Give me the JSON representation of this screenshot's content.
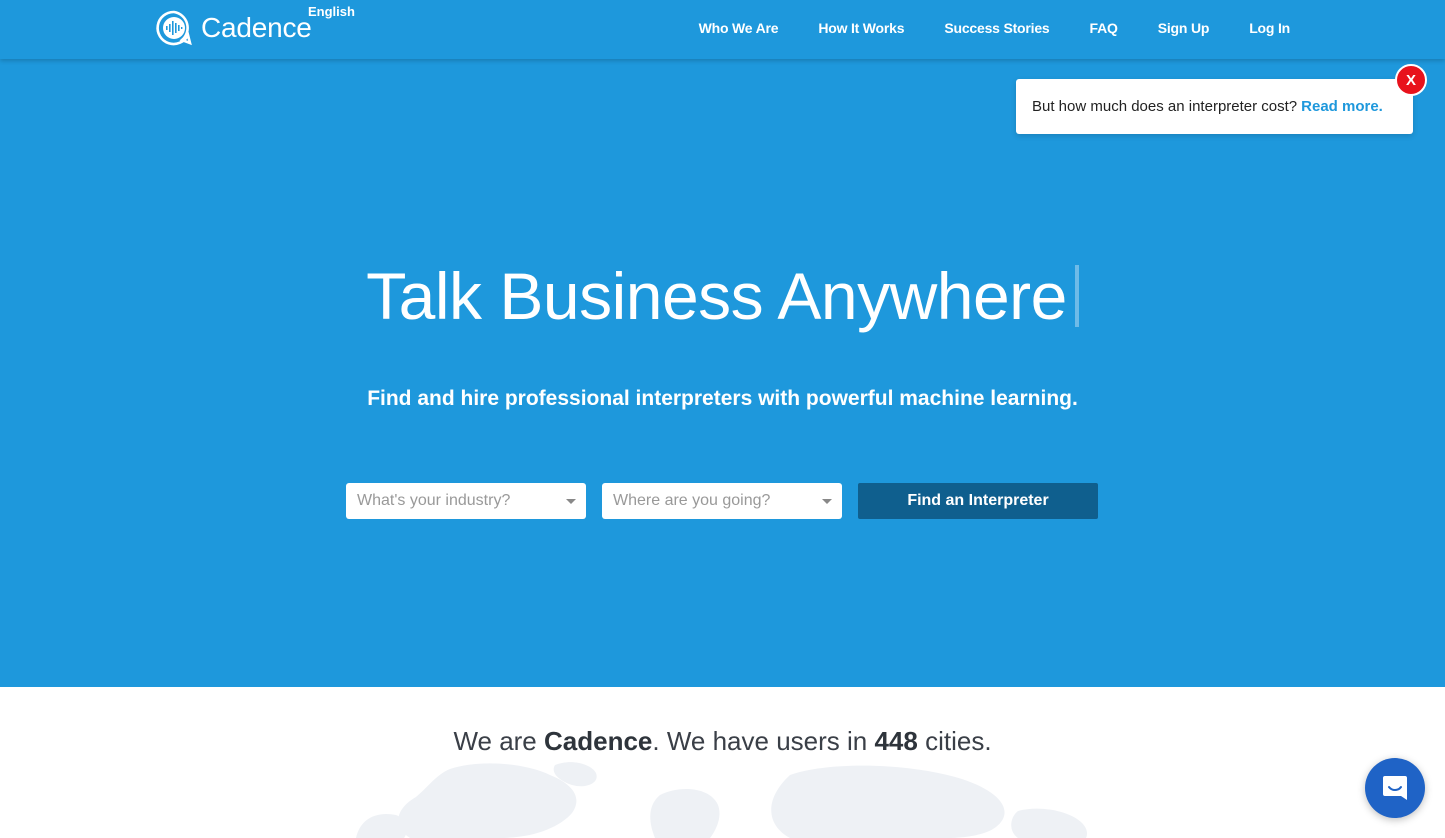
{
  "brand": {
    "name": "Cadence",
    "language": "English",
    "icon": "chat-soundwave-icon"
  },
  "nav": {
    "items": [
      {
        "label": "Who We Are"
      },
      {
        "label": "How It Works"
      },
      {
        "label": "Success Stories"
      },
      {
        "label": "FAQ"
      },
      {
        "label": "Sign Up"
      },
      {
        "label": "Log In"
      }
    ]
  },
  "promo": {
    "text": "But how much does an interpreter cost?",
    "link_label": "Read more.",
    "close_label": "X"
  },
  "hero": {
    "headline": "Talk Business Anywhere",
    "subheadline": "Find and hire professional interpreters with powerful machine learning.",
    "industry_placeholder": "What's your industry?",
    "destination_placeholder": "Where are you going?",
    "cta_label": "Find an Interpreter"
  },
  "stats": {
    "prefix": "We are ",
    "brand": "Cadence",
    "middle": ". We have users in ",
    "cities": "448",
    "suffix": " cities."
  },
  "chat": {
    "icon": "chat-bubble-icon"
  },
  "colors": {
    "primary": "#1e98dc",
    "button": "#0f5f8e",
    "close": "#e8121c",
    "chat": "#1f63c6"
  }
}
